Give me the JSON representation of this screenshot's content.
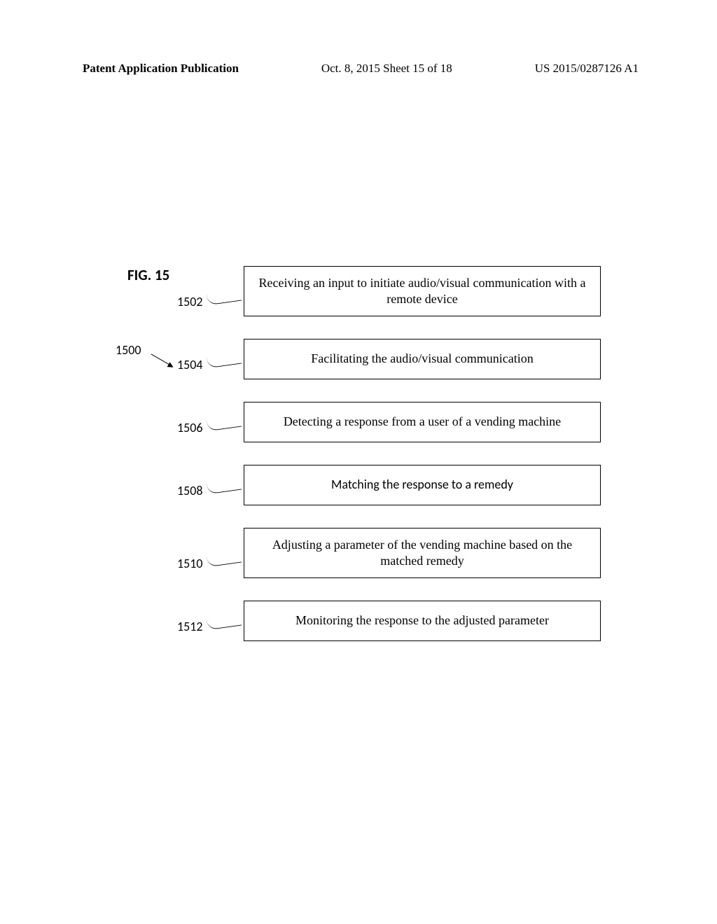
{
  "header": {
    "left": "Patent Application Publication",
    "center": "Oct. 8, 2015  Sheet 15 of 18",
    "right": "US 2015/0287126 A1"
  },
  "figure_label": "FIG. 15",
  "ref_1500": "1500",
  "steps": [
    {
      "ref": "1502",
      "text": "Receiving an input to initiate audio/visual communication with a remote device",
      "font": "times"
    },
    {
      "ref": "1504",
      "text": "Facilitating the audio/visual communication",
      "font": "times"
    },
    {
      "ref": "1506",
      "text": "Detecting a response from a user of a vending machine",
      "font": "times"
    },
    {
      "ref": "1508",
      "text": "Matching the response to a remedy",
      "font": "calibri"
    },
    {
      "ref": "1510",
      "text": "Adjusting a parameter of the vending machine based on the matched remedy",
      "font": "times"
    },
    {
      "ref": "1512",
      "text": "Monitoring the response to the adjusted parameter",
      "font": "times"
    }
  ]
}
